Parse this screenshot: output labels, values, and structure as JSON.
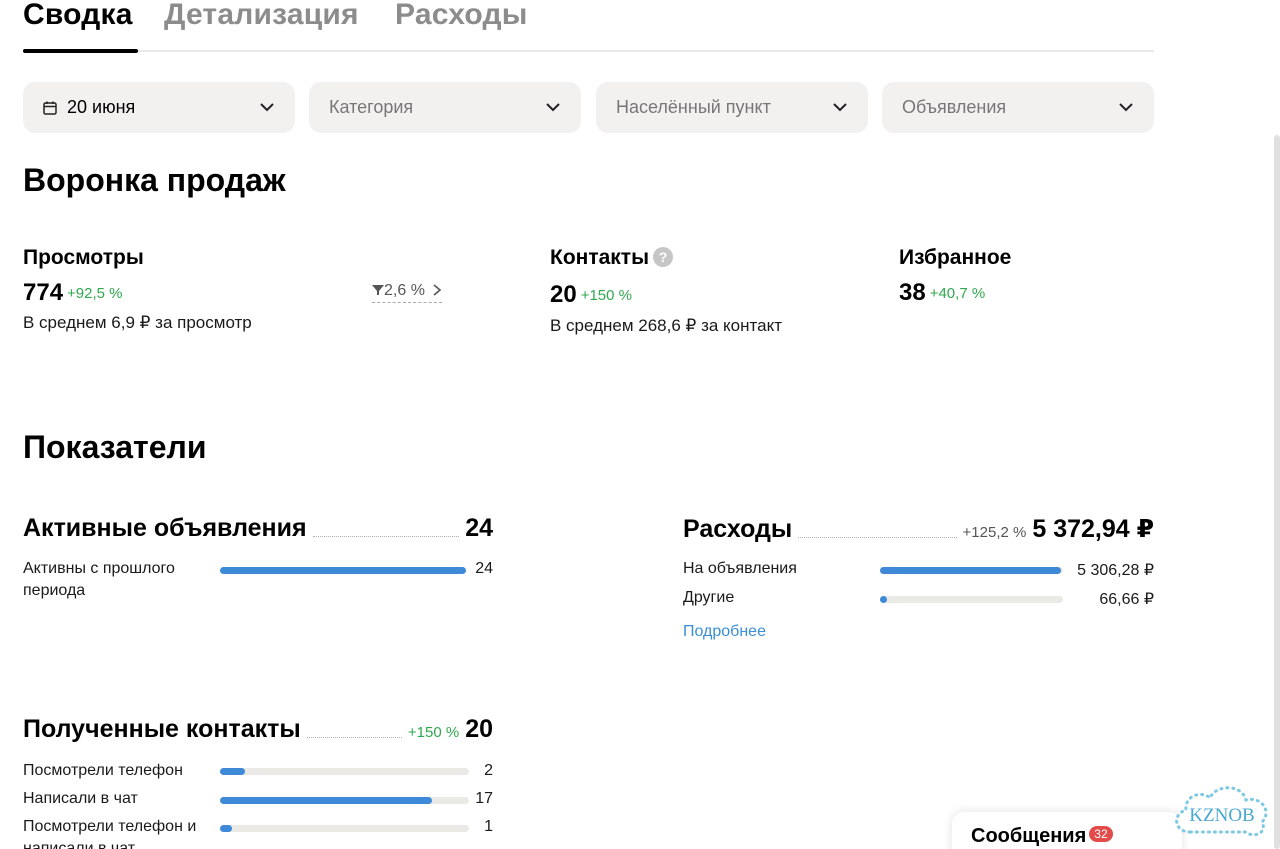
{
  "tabs": [
    {
      "label": "Сводка",
      "active": true
    },
    {
      "label": "Детализация",
      "active": false
    },
    {
      "label": "Расходы",
      "active": false
    }
  ],
  "filters": {
    "date": {
      "value": "20 июня",
      "icon": "calendar-icon"
    },
    "category": {
      "placeholder": "Категория"
    },
    "locality": {
      "placeholder": "Населённый пункт"
    },
    "ads": {
      "placeholder": "Объявления"
    }
  },
  "funnel": {
    "title": "Воронка продаж",
    "views": {
      "title": "Просмотры",
      "value": "774",
      "delta": "+92,5 %",
      "sub": "В среднем 6,9 ₽ за просмотр",
      "conversion": "2,6 %"
    },
    "contacts": {
      "title": "Контакты",
      "help": "?",
      "value": "20",
      "delta": "+150 %",
      "sub": "В среднем 268,6 ₽ за контакт"
    },
    "favorites": {
      "title": "Избранное",
      "value": "38",
      "delta": "+40,7 %"
    }
  },
  "indicators": {
    "title": "Показатели",
    "active_ads": {
      "title": "Активные объявления",
      "value": "24",
      "rows": [
        {
          "label": "Активны с прошлого периода",
          "value": "24",
          "fill": 1.0
        }
      ]
    },
    "expenses": {
      "title": "Расходы",
      "delta": "+125,2 %",
      "value": "5 372,94 ₽",
      "rows": [
        {
          "label": "На объявления",
          "value": "5 306,28 ₽",
          "fill": 0.99
        },
        {
          "label": "Другие",
          "value": "66,66 ₽",
          "fill": 0.04
        }
      ],
      "more_link": "Подробнее"
    },
    "received_contacts": {
      "title": "Полученные контакты",
      "delta": "+150 %",
      "value": "20",
      "rows": [
        {
          "label": "Посмотрели телефон",
          "value": "2",
          "fill": 0.1
        },
        {
          "label": "Написали в чат",
          "value": "17",
          "fill": 0.85
        },
        {
          "label": "Посмотрели телефон и написали в чат",
          "value": "1",
          "fill": 0.05
        }
      ]
    }
  },
  "messages": {
    "label": "Сообщения",
    "count": "32"
  },
  "watermark": {
    "text": "KZNOB"
  },
  "colors": {
    "accent": "#3f8ad8",
    "positive": "#2fa84f",
    "badge": "#e34b4b"
  }
}
